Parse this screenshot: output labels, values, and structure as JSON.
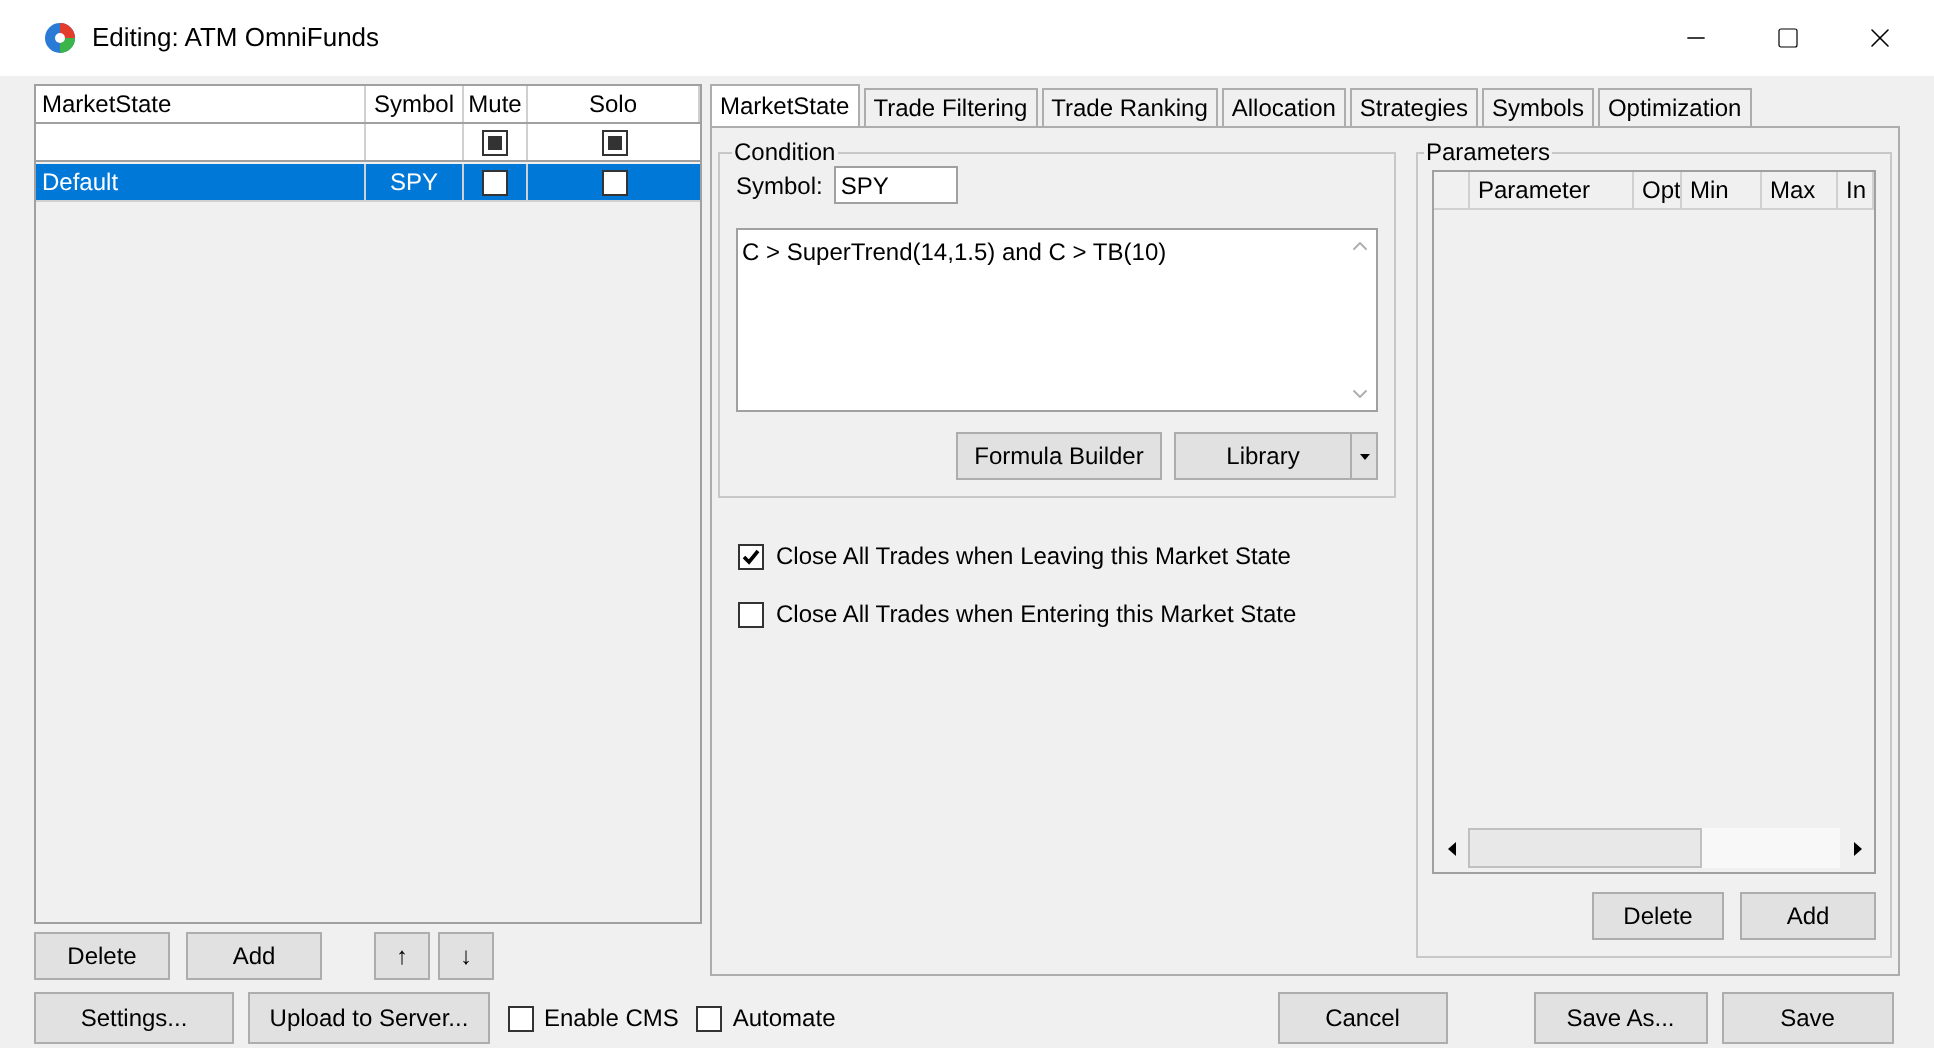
{
  "window": {
    "title": "Editing: ATM OmniFunds"
  },
  "states_list": {
    "columns": [
      {
        "label": "MarketState"
      },
      {
        "label": "Symbol"
      },
      {
        "label": "Mute"
      },
      {
        "label": "Solo"
      }
    ],
    "filter_row": {
      "mute_checked": true,
      "solo_checked": true
    },
    "rows": [
      {
        "name": "Default",
        "symbol": "SPY",
        "mute": false,
        "solo": false,
        "selected": true
      }
    ],
    "buttons": [
      "Delete",
      "Add",
      "↑",
      "↓"
    ]
  },
  "tabs": [
    {
      "label": "MarketState",
      "selected": true
    },
    {
      "label": "Trade Filtering",
      "selected": false
    },
    {
      "label": "Trade Ranking",
      "selected": false
    },
    {
      "label": "Allocation",
      "selected": false
    },
    {
      "label": "Strategies",
      "selected": false
    },
    {
      "label": "Symbols",
      "selected": false
    },
    {
      "label": "Optimization",
      "selected": false
    }
  ],
  "condition": {
    "legend": "Condition",
    "symbol_label": "Symbol:",
    "symbol_value": "SPY",
    "formula": "C > SuperTrend(14,1.5) and C > TB(10)",
    "buttons": [
      "Formula Builder",
      "Library"
    ]
  },
  "options": [
    {
      "label": "Close All Trades when Leaving this Market State",
      "checked": true
    },
    {
      "label": "Close All Trades when Entering this Market State",
      "checked": false
    }
  ],
  "parameters": {
    "legend": "Parameters",
    "columns": [
      "Parameter",
      "Opt",
      "Min",
      "Max",
      "In"
    ],
    "buttons": [
      "Delete",
      "Add"
    ]
  },
  "footer": {
    "left_buttons": [
      "Settings...",
      "Upload to Server..."
    ],
    "checks": [
      {
        "label": "Enable CMS",
        "checked": false
      },
      {
        "label": "Automate",
        "checked": false
      }
    ],
    "right_buttons": [
      "Cancel",
      "Save As...",
      "Save"
    ]
  }
}
